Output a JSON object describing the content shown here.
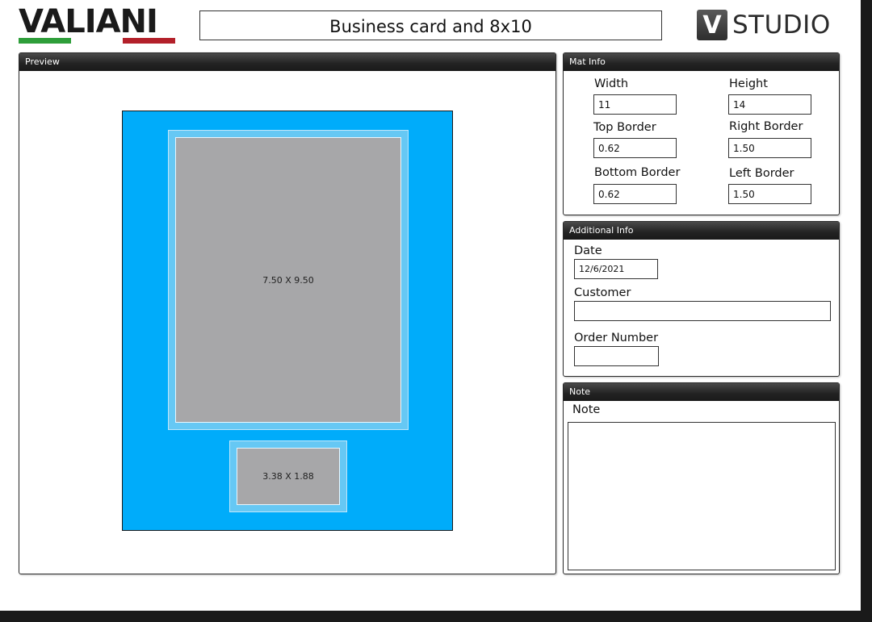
{
  "header": {
    "logo_text": "VALIANI",
    "flag_colors": [
      "#2e9e3a",
      "#ffffff",
      "#b3202a"
    ],
    "title": "Business card and 8x10",
    "studio_badge": "V",
    "studio_text": "STUDIO"
  },
  "preview": {
    "title": "Preview",
    "mat_color": "#00acfa",
    "openings": [
      {
        "label": "7.50 X 9.50"
      },
      {
        "label": "3.38 X 1.88"
      }
    ]
  },
  "mat_info": {
    "title": "Mat Info",
    "width_label": "Width",
    "width_value": "11",
    "height_label": "Height",
    "height_value": "14",
    "top_label": "Top Border",
    "top_value": "0.62",
    "right_label": "Right Border",
    "right_value": "1.50",
    "bottom_label": "Bottom Border",
    "bottom_value": "0.62",
    "left_label": "Left Border",
    "left_value": "1.50"
  },
  "additional_info": {
    "title": "Additional Info",
    "date_label": "Date",
    "date_value": "12/6/2021",
    "customer_label": "Customer",
    "customer_value": "",
    "order_label": "Order Number",
    "order_value": ""
  },
  "note": {
    "title": "Note",
    "label": "Note",
    "value": ""
  }
}
